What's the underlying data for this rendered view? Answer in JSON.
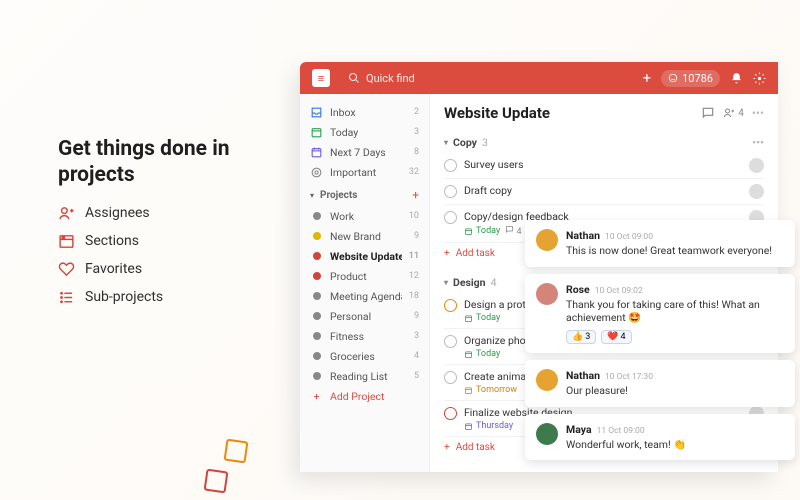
{
  "promo": {
    "headline": "Get things done in projects",
    "features": [
      {
        "label": "Assignees",
        "icon": "user-plus-icon"
      },
      {
        "label": "Sections",
        "icon": "sections-icon"
      },
      {
        "label": "Favorites",
        "icon": "heart-icon"
      },
      {
        "label": "Sub-projects",
        "icon": "list-icon"
      }
    ]
  },
  "topbar": {
    "search_placeholder": "Quick find",
    "karma": "10786"
  },
  "sidebar": {
    "filters": [
      {
        "label": "Inbox",
        "count": "2",
        "icon": "inbox-icon",
        "color": "#3870e0"
      },
      {
        "label": "Today",
        "count": "3",
        "icon": "today-icon",
        "color": "#2a9d4e"
      },
      {
        "label": "Next 7 Days",
        "count": "8",
        "icon": "calendar-icon",
        "color": "#6e5bd6"
      },
      {
        "label": "Important",
        "count": "32",
        "icon": "bookmark-icon",
        "color": "#888"
      }
    ],
    "projects_header": "Projects",
    "projects": [
      {
        "label": "Work",
        "count": "10",
        "color": "#888"
      },
      {
        "label": "New Brand",
        "count": "9",
        "color": "#e0b800"
      },
      {
        "label": "Website Update",
        "count": "11",
        "color": "#d1453b",
        "active": true
      },
      {
        "label": "Product",
        "count": "12",
        "color": "#d1453b"
      },
      {
        "label": "Meeting Agenda",
        "count": "18",
        "color": "#888"
      },
      {
        "label": "Personal",
        "count": "9",
        "color": "#888"
      },
      {
        "label": "Fitness",
        "count": "3",
        "color": "#888"
      },
      {
        "label": "Groceries",
        "count": "4",
        "color": "#888"
      },
      {
        "label": "Reading List",
        "count": "5",
        "color": "#888"
      }
    ],
    "add_project": "Add Project"
  },
  "main": {
    "title": "Website Update",
    "share_count": "4",
    "sections": [
      {
        "name": "Copy",
        "count": "3",
        "tasks": [
          {
            "title": "Survey users",
            "priority": ""
          },
          {
            "title": "Draft copy",
            "priority": ""
          },
          {
            "title": "Copy/design feedback",
            "priority": "",
            "due": "Today",
            "due_class": "today",
            "comments": "4"
          }
        ]
      },
      {
        "name": "Design",
        "count": "4",
        "tasks": [
          {
            "title": "Design a prototype",
            "priority": "p2",
            "due": "Today",
            "due_class": "today"
          },
          {
            "title": "Organize photo shoot",
            "priority": "",
            "due": "Today",
            "due_class": "today"
          },
          {
            "title": "Create animations",
            "priority": "",
            "due": "Tomorrow",
            "due_class": "tomorrow"
          },
          {
            "title": "Finalize website design",
            "priority": "p1",
            "due": "Thursday",
            "due_class": "later"
          }
        ]
      }
    ],
    "add_task": "Add task"
  },
  "comments": [
    {
      "author": "Nathan",
      "time": "10 Oct 09:00",
      "text": "This is now done! Great teamwork everyone!",
      "avatar": "#e5a432"
    },
    {
      "author": "Rose",
      "time": "10 Oct 09:02",
      "text": "Thank you for taking care of this! What an achievement 🤩",
      "avatar": "#d4857a",
      "reactions": [
        {
          "emoji": "👍",
          "count": "3"
        },
        {
          "emoji": "❤️",
          "count": "4"
        }
      ]
    },
    {
      "author": "Nathan",
      "time": "10 Oct 17:30",
      "text": "Our pleasure!",
      "avatar": "#e5a432"
    },
    {
      "author": "Maya",
      "time": "11 Oct 09:00",
      "text": "Wonderful work, team! 👏",
      "avatar": "#3e7a4e"
    }
  ]
}
